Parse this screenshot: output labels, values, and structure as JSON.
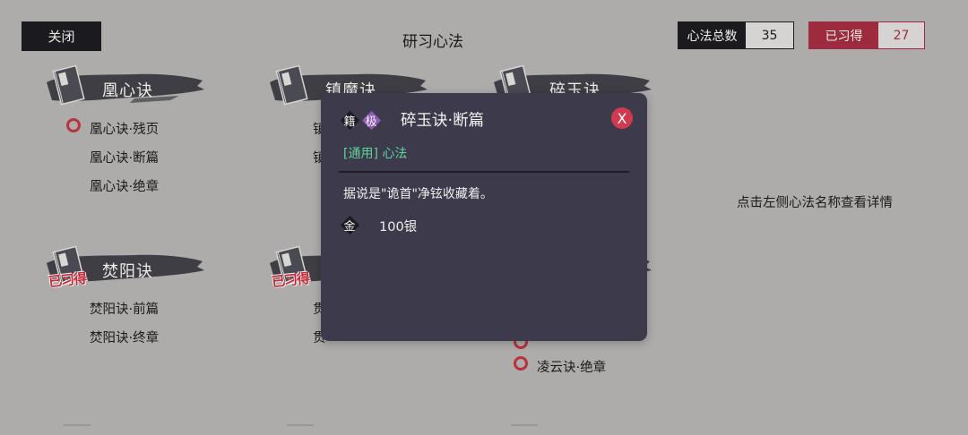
{
  "header": {
    "close_label": "关闭",
    "title": "研习心法",
    "total_label": "心法总数",
    "total_value": "35",
    "learned_label": "已习得",
    "learned_value": "27"
  },
  "groups": [
    {
      "name": "凰心诀",
      "learned": false,
      "items": [
        "凰心诀·残页",
        "凰心诀·断篇",
        "凰心诀·绝章"
      ]
    },
    {
      "name": "镇魔诀",
      "learned": false,
      "items": [
        "镇",
        "镇"
      ]
    },
    {
      "name": "碎玉诀",
      "learned": false,
      "items": []
    },
    {
      "name": "焚阳诀",
      "learned": true,
      "items": [
        "焚阳诀·前篇",
        "焚阳诀·终章"
      ]
    },
    {
      "name": "",
      "learned": true,
      "items": [
        "贯",
        "贯"
      ]
    },
    {
      "name": "",
      "learned": false,
      "items": [
        "凌云诀·绝章"
      ]
    }
  ],
  "seal_text": "已习得",
  "hint": "点击左侧心法名称查看详情",
  "modal": {
    "tag_book": "籍",
    "tag_grade": "极",
    "name": "碎玉诀·断篇",
    "close": "X",
    "category": "[通用] 心法",
    "description": "据说是\"诡首\"净铉收藏着。",
    "currency_icon": "金",
    "price": "100银"
  },
  "colors": {
    "background": "#aeacab",
    "dark": "#1b1b1f",
    "accent_red": "#9e2b3d",
    "modal_bg": "#3d3a4c",
    "category_green": "#5ed39a",
    "grade_purple": "#8e5ab8",
    "close_red": "#d13a4e"
  }
}
